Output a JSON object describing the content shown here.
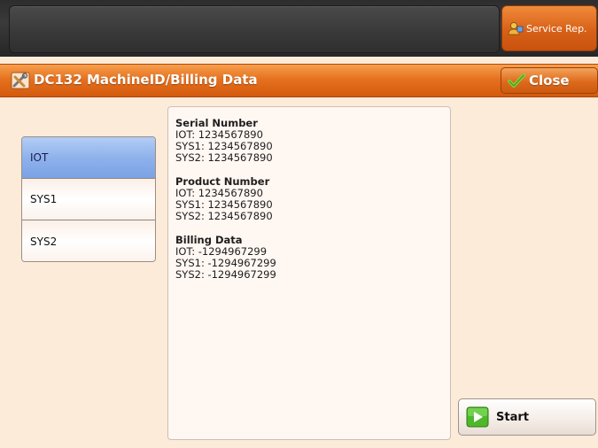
{
  "header": {
    "service_button_label": "Service Rep."
  },
  "titlebar": {
    "title": "DC132 MachineID/Billing Data",
    "close_label": "Close"
  },
  "tabs": [
    {
      "label": "IOT",
      "selected": true
    },
    {
      "label": "SYS1",
      "selected": false
    },
    {
      "label": "SYS2",
      "selected": false
    }
  ],
  "info": {
    "serial": {
      "heading": "Serial Number",
      "lines": [
        "IOT: 1234567890",
        "SYS1: 1234567890",
        "SYS2: 1234567890"
      ]
    },
    "product": {
      "heading": "Product Number",
      "lines": [
        "IOT: 1234567890",
        "SYS1: 1234567890",
        "SYS2: 1234567890"
      ]
    },
    "billing": {
      "heading": "Billing Data",
      "lines": [
        "IOT: -1294967299",
        "SYS1: -1294967299",
        "SYS2: -1294967299"
      ]
    }
  },
  "start_label": "Start",
  "colors": {
    "accent_orange": "#e6711f",
    "selected_tab_blue": "#8fb2ec",
    "background": "#fdebd9",
    "start_icon_green": "#4cb82a"
  },
  "icons": {
    "service": "service-rep-icon",
    "title": "tools-icon",
    "close": "checkmark-icon",
    "start": "play-icon"
  }
}
